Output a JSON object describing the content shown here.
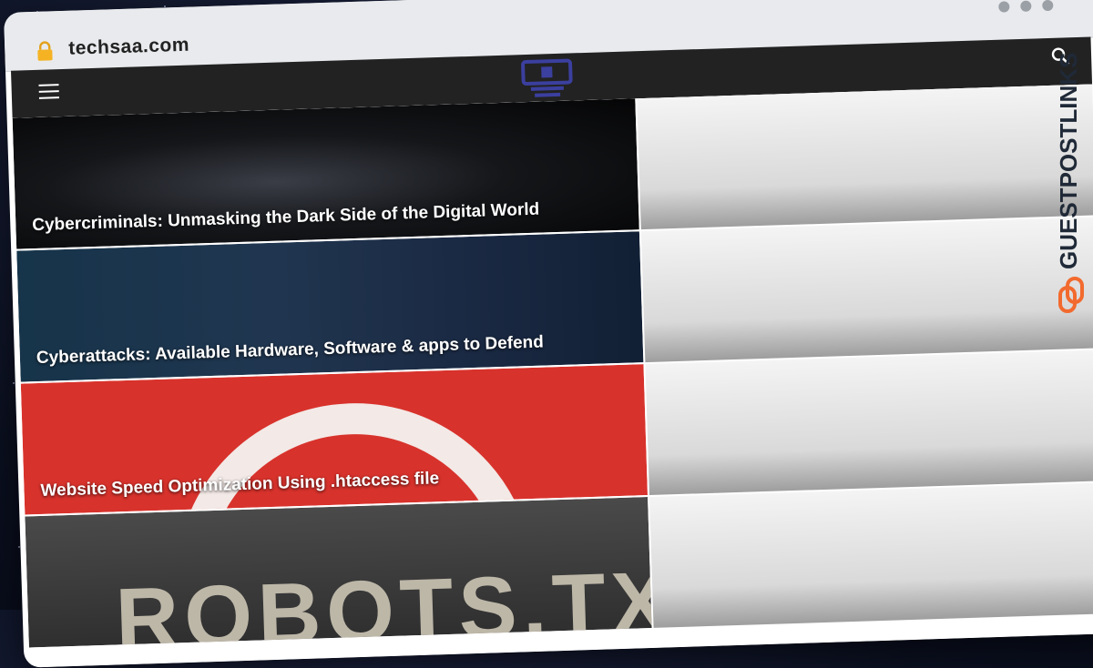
{
  "browser": {
    "url": "techsaa.com"
  },
  "nav": {
    "menu_icon": "hamburger-menu-icon",
    "logo_icon": "site-logo-icon",
    "search_icon": "search-icon"
  },
  "articles": [
    {
      "title": "Cybercriminals: Unmasking the Dark Side of the Digital World"
    },
    {
      "title": "Cyberattacks: Available Hardware, Software & apps to Defend"
    },
    {
      "title": "Website Speed Optimization Using .htaccess file"
    },
    {
      "title": "",
      "image_text": "ROBOTS.TXT"
    }
  ],
  "watermark": {
    "text": "GUESTPOSTLINKS"
  },
  "colors": {
    "navbar": "#222222",
    "titlebar": "#e8eaed",
    "accent_red": "#d8322c",
    "watermark_text": "#1f2937",
    "watermark_icon": "#f26a2e"
  }
}
